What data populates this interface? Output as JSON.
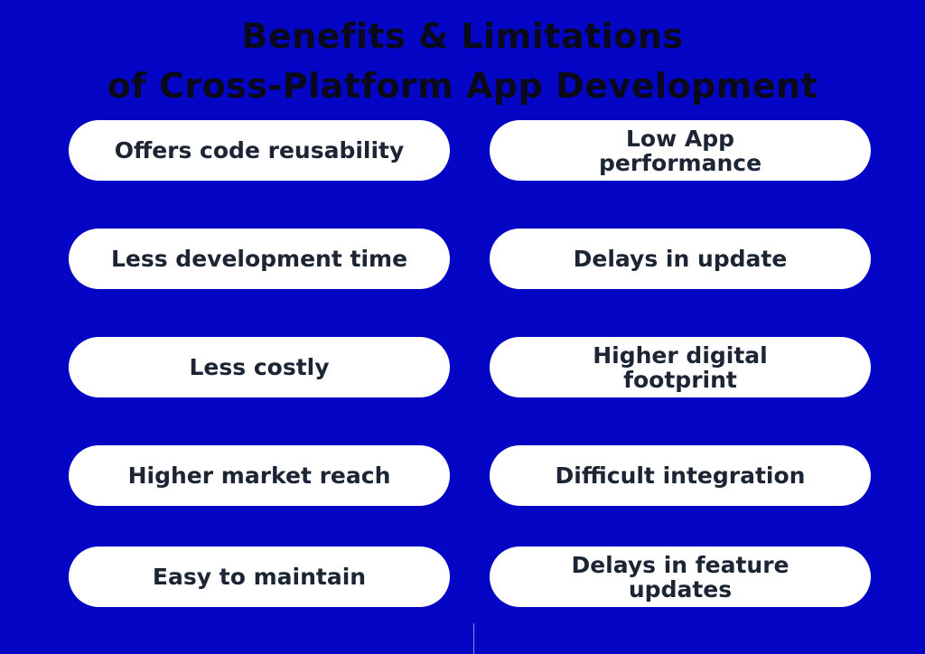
{
  "title": {
    "line1": "Benefits  &  Limitations",
    "line2": "of Cross-Platform App Development"
  },
  "benefits": [
    "Offers code reusability",
    "Less development time",
    "Less costly",
    "Higher market reach",
    "Easy to maintain"
  ],
  "limitations": [
    "Low App performance",
    "Delays in update",
    "Higher digital footprint",
    "Difficult integration",
    "Delays in feature updates"
  ],
  "colors": {
    "background": "#0505c5",
    "pill": "#ffffff",
    "pill_text": "#1c2533",
    "title": "#0a0a1a"
  }
}
